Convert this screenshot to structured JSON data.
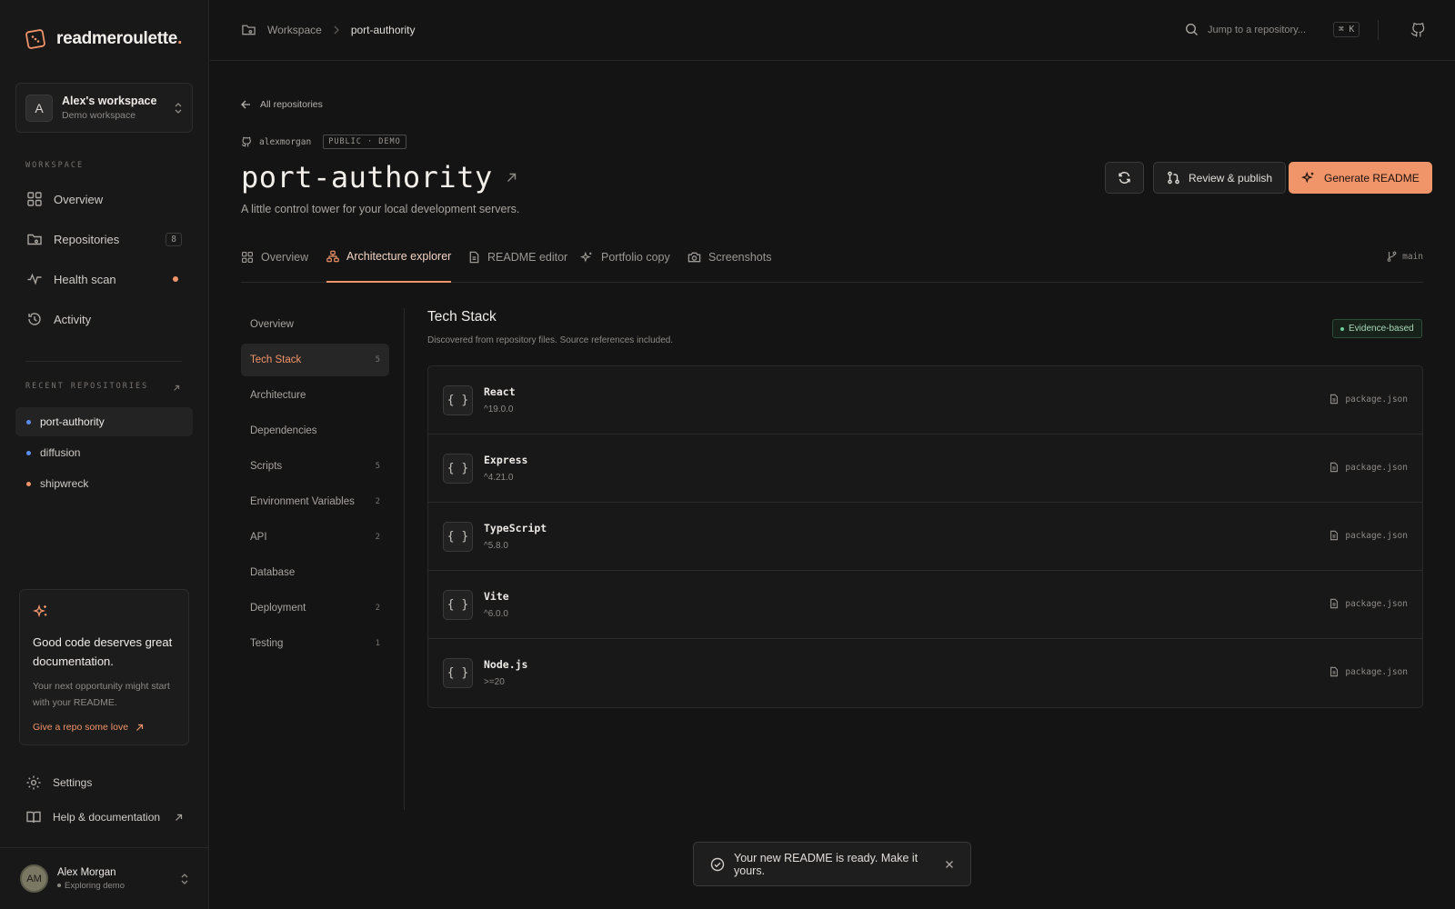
{
  "brand": {
    "name": "readmeroulette",
    "dot": "."
  },
  "workspace": {
    "initial": "A",
    "name": "Alex's workspace",
    "subtitle": "Demo workspace"
  },
  "sidebar": {
    "section_label": "WORKSPACE",
    "items": [
      {
        "label": "Overview",
        "icon": "grid-icon"
      },
      {
        "label": "Repositories",
        "icon": "folder-git-icon",
        "count": "8"
      },
      {
        "label": "Health scan",
        "icon": "pulse-icon",
        "alert": true
      },
      {
        "label": "Activity",
        "icon": "history-icon"
      }
    ],
    "recent_label": "RECENT REPOSITORIES",
    "recent": [
      {
        "name": "port-authority",
        "dot_color": "#5b8def",
        "active": true
      },
      {
        "name": "diffusion",
        "dot_color": "#5b8def"
      },
      {
        "name": "shipwreck",
        "dot_color": "#f0946a"
      }
    ],
    "promo": {
      "title": "Good code deserves great documentation.",
      "body": "Your next opportunity might start with your README.",
      "link": "Give a repo some love"
    },
    "settings": "Settings",
    "help": "Help & documentation",
    "user": {
      "initials": "AM",
      "name": "Alex Morgan",
      "status": "Exploring demo"
    }
  },
  "topbar": {
    "breadcrumb_root": "Workspace",
    "breadcrumb_current": "port-authority",
    "search_placeholder": "Jump to a repository...",
    "shortcut": "⌘ K"
  },
  "repo": {
    "back_label": "All repositories",
    "owner": "alexmorgan",
    "visibility": "PUBLIC · DEMO",
    "name": "port-authority",
    "description": "A little control tower for your local development servers.",
    "actions": {
      "review": "Review & publish",
      "generate": "Generate README"
    }
  },
  "tabs": [
    {
      "label": "Overview",
      "icon": "grid-icon"
    },
    {
      "label": "Architecture explorer",
      "icon": "hierarchy-icon",
      "active": true
    },
    {
      "label": "README editor",
      "icon": "file-icon"
    },
    {
      "label": "Portfolio copy",
      "icon": "sparkles-icon"
    },
    {
      "label": "Screenshots",
      "icon": "camera-icon"
    }
  ],
  "branch": "main",
  "subnav": [
    {
      "label": "Overview",
      "count": ""
    },
    {
      "label": "Tech Stack",
      "count": "5",
      "active": true
    },
    {
      "label": "Architecture",
      "count": ""
    },
    {
      "label": "Dependencies",
      "count": ""
    },
    {
      "label": "Scripts",
      "count": "5"
    },
    {
      "label": "Environment Variables",
      "count": "2"
    },
    {
      "label": "API",
      "count": "2"
    },
    {
      "label": "Database",
      "count": ""
    },
    {
      "label": "Deployment",
      "count": "2"
    },
    {
      "label": "Testing",
      "count": "1"
    }
  ],
  "panel": {
    "title": "Tech Stack",
    "subtitle": "Discovered from repository files. Source references included.",
    "badge": "Evidence-based",
    "items": [
      {
        "name": "React",
        "version": "^19.0.0",
        "source": "package.json"
      },
      {
        "name": "Express",
        "version": "^4.21.0",
        "source": "package.json"
      },
      {
        "name": "TypeScript",
        "version": "^5.8.0",
        "source": "package.json"
      },
      {
        "name": "Vite",
        "version": "^6.0.0",
        "source": "package.json"
      },
      {
        "name": "Node.js",
        "version": ">=20",
        "source": "package.json"
      }
    ]
  },
  "toast": {
    "message": "Your new README is ready. Make it yours."
  }
}
